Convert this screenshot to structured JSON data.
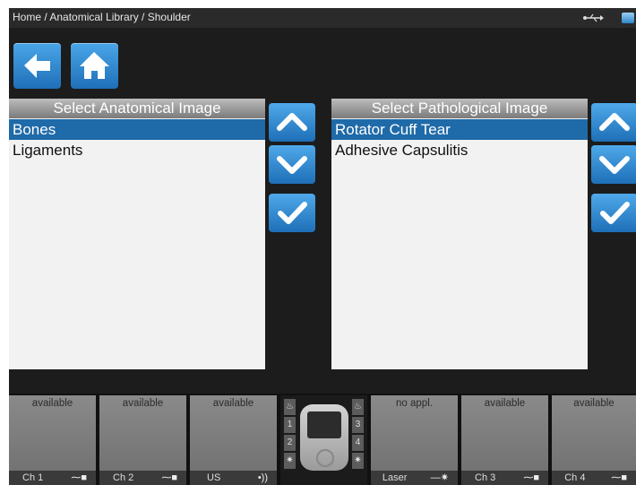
{
  "topbar": {
    "breadcrumb": "Home / Anatomical Library / Shoulder"
  },
  "nav": {
    "back_icon": "arrow-left-icon",
    "home_icon": "home-icon"
  },
  "anatomical": {
    "header": "Select Anatomical Image",
    "items": [
      {
        "label": "Bones",
        "selected": true
      },
      {
        "label": "Ligaments",
        "selected": false
      }
    ]
  },
  "pathological": {
    "header": "Select Pathological Image",
    "items": [
      {
        "label": "Rotator Cuff Tear",
        "selected": true
      },
      {
        "label": "Adhesive Capsulitis",
        "selected": false
      }
    ]
  },
  "channels": [
    {
      "status": "available",
      "label": "Ch 1",
      "icon": "electrode-icon"
    },
    {
      "status": "available",
      "label": "Ch 2",
      "icon": "electrode-icon"
    },
    {
      "status": "available",
      "label": "US",
      "icon": "ultrasound-icon"
    },
    {
      "status": "no appl.",
      "label": "Laser",
      "icon": "laser-icon"
    },
    {
      "status": "available",
      "label": "Ch 3",
      "icon": "electrode-icon"
    },
    {
      "status": "available",
      "label": "Ch 4",
      "icon": "electrode-icon"
    }
  ],
  "device": {
    "slots_left": [
      "1",
      "2"
    ],
    "slots_right": [
      "3",
      "4"
    ]
  },
  "colors": {
    "accent": "#1f6fb8",
    "selection": "#1f6aa8",
    "background": "#1c1c1c"
  }
}
